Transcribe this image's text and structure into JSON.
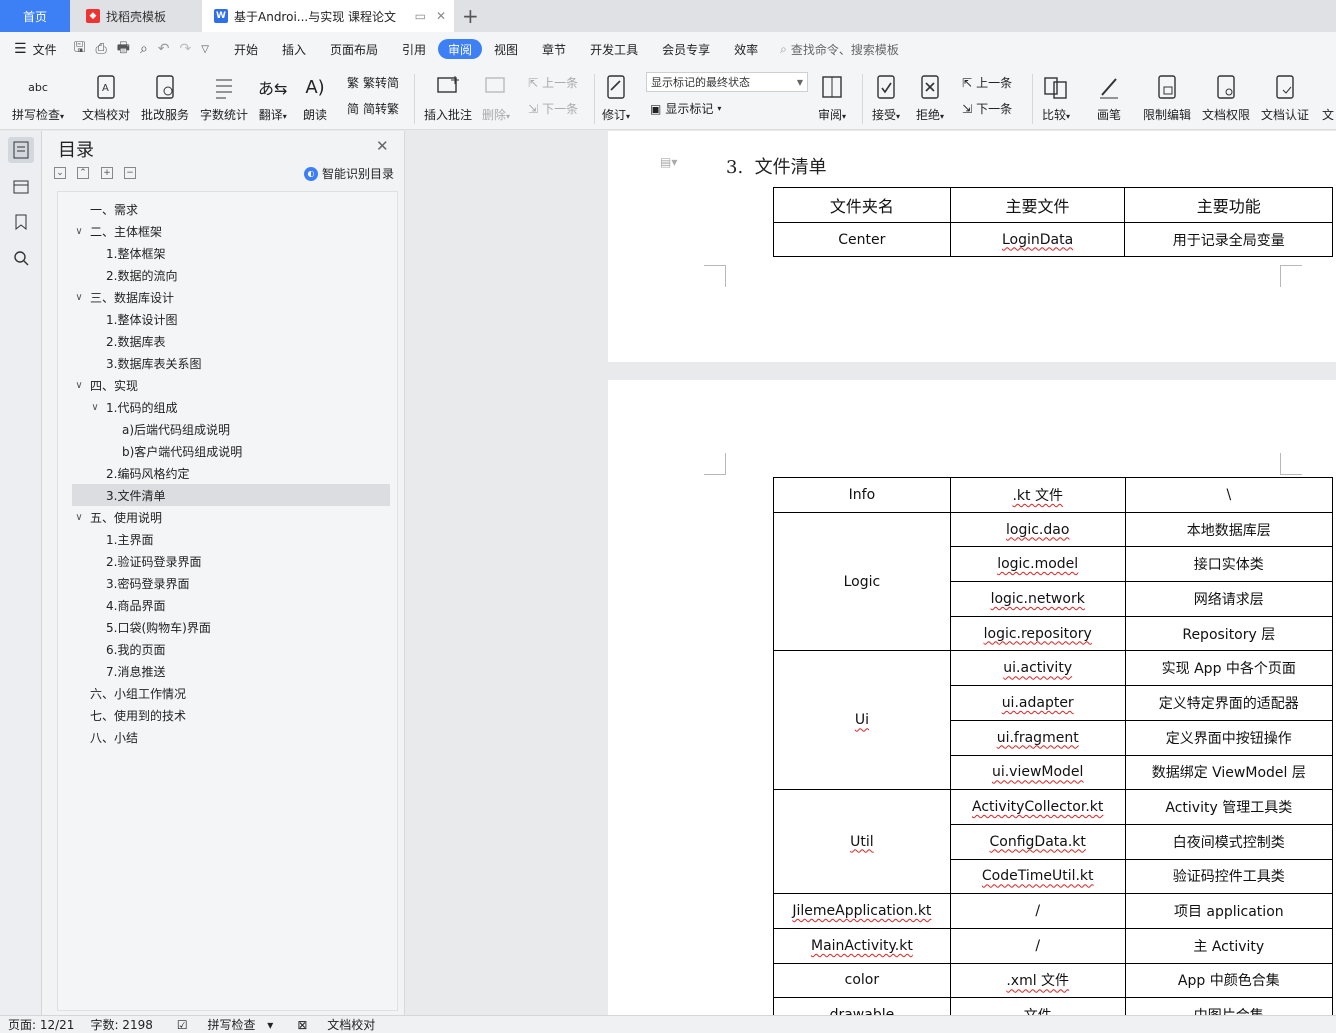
{
  "tabs": {
    "home": "首页",
    "template": "找稻壳模板",
    "doc": "基于Androi...与实现 课程论文"
  },
  "menu": {
    "file": "文件",
    "items": [
      "开始",
      "插入",
      "页面布局",
      "引用",
      "审阅",
      "视图",
      "章节",
      "开发工具",
      "会员专享",
      "效率"
    ],
    "active": "审阅",
    "search": "查找命令、搜索模板"
  },
  "ribbon": {
    "spell": "拼写检查",
    "proof": "文档校对",
    "revise_service": "批改服务",
    "word_count": "字数统计",
    "translate": "翻译",
    "read_aloud": "朗读",
    "trad": "繁转简",
    "simp": "简转繁",
    "insert_comment": "插入批注",
    "delete": "删除",
    "prev_comment": "上一条",
    "next_comment": "下一条",
    "track": "修订",
    "markup_state": "显示标记的最终状态",
    "show_markup": "显示标记",
    "review_pane": "审阅",
    "accept": "接受",
    "reject": "拒绝",
    "prev_change": "上一条",
    "next_change": "下一条",
    "compare": "比较",
    "pen": "画笔",
    "restrict": "限制编辑",
    "permission": "文档权限",
    "certify": "文档认证",
    "more": "文"
  },
  "toc": {
    "title": "目录",
    "smart": "智能识别目录",
    "items": [
      {
        "label": "一、需求",
        "level": 0,
        "toggle": ""
      },
      {
        "label": "二、主体框架",
        "level": 0,
        "toggle": "v"
      },
      {
        "label": "1.整体框架",
        "level": 1,
        "toggle": ""
      },
      {
        "label": "2.数据的流向",
        "level": 1,
        "toggle": ""
      },
      {
        "label": "三、数据库设计",
        "level": 0,
        "toggle": "v"
      },
      {
        "label": "1.整体设计图",
        "level": 1,
        "toggle": ""
      },
      {
        "label": "2.数据库表",
        "level": 1,
        "toggle": ""
      },
      {
        "label": "3.数据库表关系图",
        "level": 1,
        "toggle": ""
      },
      {
        "label": "四、实现",
        "level": 0,
        "toggle": "v"
      },
      {
        "label": "1.代码的组成",
        "level": 1,
        "toggle": "v"
      },
      {
        "label": "a)后端代码组成说明",
        "level": 2,
        "toggle": ""
      },
      {
        "label": "b)客户端代码组成说明",
        "level": 2,
        "toggle": ""
      },
      {
        "label": "2.编码风格约定",
        "level": 1,
        "toggle": ""
      },
      {
        "label": "3.文件清单",
        "level": 1,
        "toggle": "",
        "selected": true
      },
      {
        "label": "五、使用说明",
        "level": 0,
        "toggle": "v"
      },
      {
        "label": "1.主界面",
        "level": 1,
        "toggle": ""
      },
      {
        "label": "2.验证码登录界面",
        "level": 1,
        "toggle": ""
      },
      {
        "label": "3.密码登录界面",
        "level": 1,
        "toggle": ""
      },
      {
        "label": "4.商品界面",
        "level": 1,
        "toggle": ""
      },
      {
        "label": "5.口袋(购物车)界面",
        "level": 1,
        "toggle": ""
      },
      {
        "label": "6.我的页面",
        "level": 1,
        "toggle": ""
      },
      {
        "label": "7.消息推送",
        "level": 1,
        "toggle": ""
      },
      {
        "label": "六、小组工作情况",
        "level": 0,
        "toggle": ""
      },
      {
        "label": "七、使用到的技术",
        "level": 0,
        "toggle": ""
      },
      {
        "label": "八、小结",
        "level": 0,
        "toggle": ""
      }
    ]
  },
  "document": {
    "heading_num": "3.",
    "heading": "文件清单",
    "table1": {
      "headers": [
        "文件夹名",
        "主要文件",
        "主要功能"
      ],
      "rows": [
        [
          "Center",
          "LoginData",
          "用于记录全局变量"
        ]
      ]
    },
    "table2": {
      "rows": [
        {
          "folder": "Info",
          "span": 1,
          "files": [
            [
              ".kt 文件",
              "\\"
            ]
          ]
        },
        {
          "folder": "Logic",
          "span": 4,
          "files": [
            [
              "logic.dao",
              "本地数据库层"
            ],
            [
              "logic.model",
              "接口实体类"
            ],
            [
              "logic.network",
              "网络请求层"
            ],
            [
              "logic.repository",
              "Repository 层"
            ]
          ]
        },
        {
          "folder": "Ui",
          "span": 4,
          "files": [
            [
              "ui.activity",
              "实现 App 中各个页面"
            ],
            [
              "ui.adapter",
              "定义特定界面的适配器"
            ],
            [
              "ui.fragment",
              "定义界面中按钮操作"
            ],
            [
              "ui.viewModel",
              "数据绑定 ViewModel 层"
            ]
          ]
        },
        {
          "folder": "Util",
          "span": 3,
          "files": [
            [
              "ActivityCollector.kt",
              "Activity 管理工具类"
            ],
            [
              "ConfigData.kt",
              "白夜间模式控制类"
            ],
            [
              "CodeTimeUtil.kt",
              "验证码控件工具类"
            ]
          ]
        },
        {
          "folder": "JilemeApplication.kt",
          "span": 1,
          "files": [
            [
              "/",
              "项目 application"
            ]
          ]
        },
        {
          "folder": "MainActivity.kt",
          "span": 1,
          "files": [
            [
              "/",
              "主 Activity"
            ]
          ]
        },
        {
          "folder": "color",
          "span": 1,
          "files": [
            [
              ".xml 文件",
              "App 中颜色合集"
            ]
          ]
        },
        {
          "folder": "drawable",
          "span": 1,
          "files": [
            [
              "文件",
              "中图片合集"
            ]
          ]
        }
      ]
    }
  },
  "status": {
    "page": "页面: 12/21",
    "words": "字数: 2198",
    "spell": "拼写检查",
    "proof": "文档校对"
  },
  "colors": {
    "accent": "#3d7ff5",
    "tabbar": "#dfe1e5",
    "ribbon": "#f4f5f7"
  }
}
